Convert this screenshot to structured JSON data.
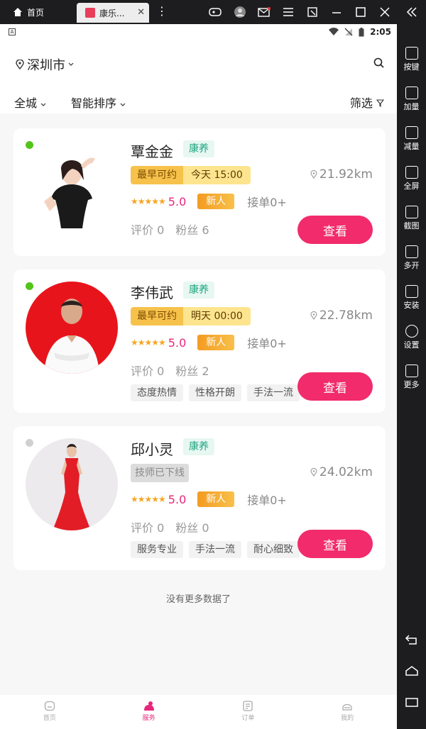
{
  "emulator": {
    "home_tab": "首页",
    "app_tab": "康乐...",
    "sidebar": [
      {
        "label": "按键",
        "icon": "keyboard-icon"
      },
      {
        "label": "加量",
        "icon": "volume-up-icon"
      },
      {
        "label": "减量",
        "icon": "volume-down-icon"
      },
      {
        "label": "全屏",
        "icon": "fullscreen-icon"
      },
      {
        "label": "截图",
        "icon": "scissors-icon"
      },
      {
        "label": "多开",
        "icon": "multi-open-icon"
      },
      {
        "label": "安装",
        "icon": "apk-install-icon"
      },
      {
        "label": "设置",
        "icon": "gear-icon"
      },
      {
        "label": "更多",
        "icon": "more-icon"
      }
    ]
  },
  "status_bar": {
    "time": "2:05"
  },
  "header": {
    "city": "深圳市",
    "filters": {
      "area": "全城",
      "sort": "智能排序",
      "screen": "筛选"
    }
  },
  "therapists": [
    {
      "name": "覃金金",
      "tag": "康养",
      "online": true,
      "avail_label": "最早可约",
      "avail_time": "今天 15:00",
      "distance": "21.92km",
      "score": "5.0",
      "badge": "新人",
      "orders": "接单0+",
      "reviews": "评价 0",
      "fans": "粉丝 6",
      "tags": [],
      "button": "查看"
    },
    {
      "name": "李伟武",
      "tag": "康养",
      "online": true,
      "avail_label": "最早可约",
      "avail_time": "明天 00:00",
      "distance": "22.78km",
      "score": "5.0",
      "badge": "新人",
      "orders": "接单0+",
      "reviews": "评价 0",
      "fans": "粉丝 2",
      "tags": [
        "态度热情",
        "性格开朗",
        "手法一流"
      ],
      "button": "查看"
    },
    {
      "name": "邱小灵",
      "tag": "康养",
      "online": false,
      "offline_label": "技师已下线",
      "distance": "24.02km",
      "score": "5.0",
      "badge": "新人",
      "orders": "接单0+",
      "reviews": "评价 0",
      "fans": "粉丝 0",
      "tags": [
        "服务专业",
        "手法一流",
        "耐心细致"
      ],
      "button": "查看"
    }
  ],
  "no_more": "没有更多数据了",
  "tabbar": [
    {
      "label": "首页",
      "active": false
    },
    {
      "label": "服务",
      "active": true
    },
    {
      "label": "订单",
      "active": false
    },
    {
      "label": "我的",
      "active": false
    }
  ],
  "colors": {
    "accent": "#f12b6c",
    "online": "#52c41a",
    "offline": "#d0d0d0",
    "tag_green": "#1aa57d"
  }
}
